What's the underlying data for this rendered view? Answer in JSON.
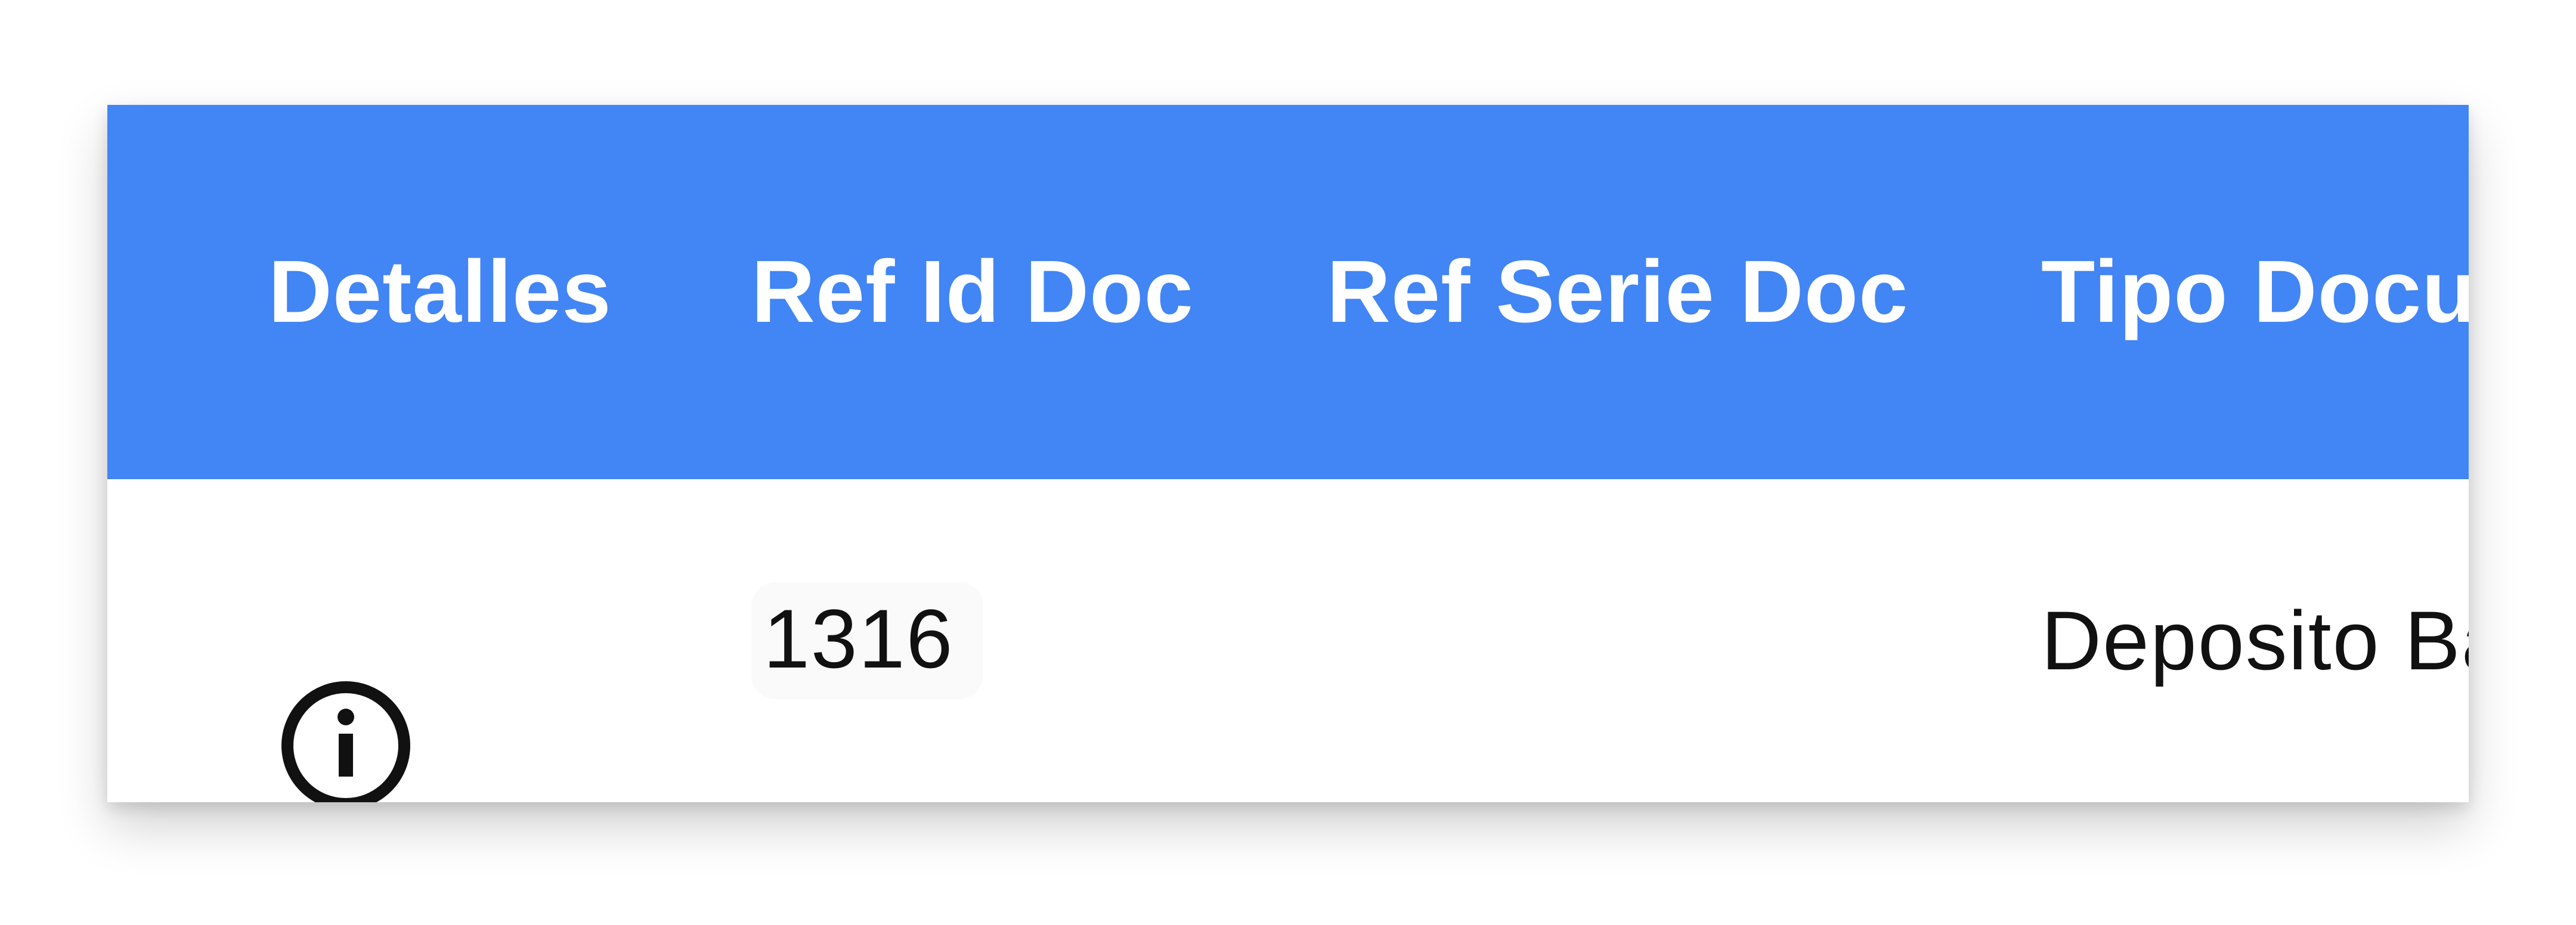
{
  "table": {
    "columns": [
      "Detalles",
      "Ref Id Doc",
      "Ref Serie Doc",
      "Tipo Documento"
    ],
    "rows": [
      {
        "detalles_icon": "info-icon",
        "ref_id_doc": "1316",
        "ref_serie_doc": "",
        "tipo_documento": "Deposito Bancario"
      }
    ]
  },
  "colors": {
    "header_bg": "#4285f4",
    "header_text": "#ffffff",
    "row_bg": "#ffffff",
    "row_text": "#111111"
  }
}
